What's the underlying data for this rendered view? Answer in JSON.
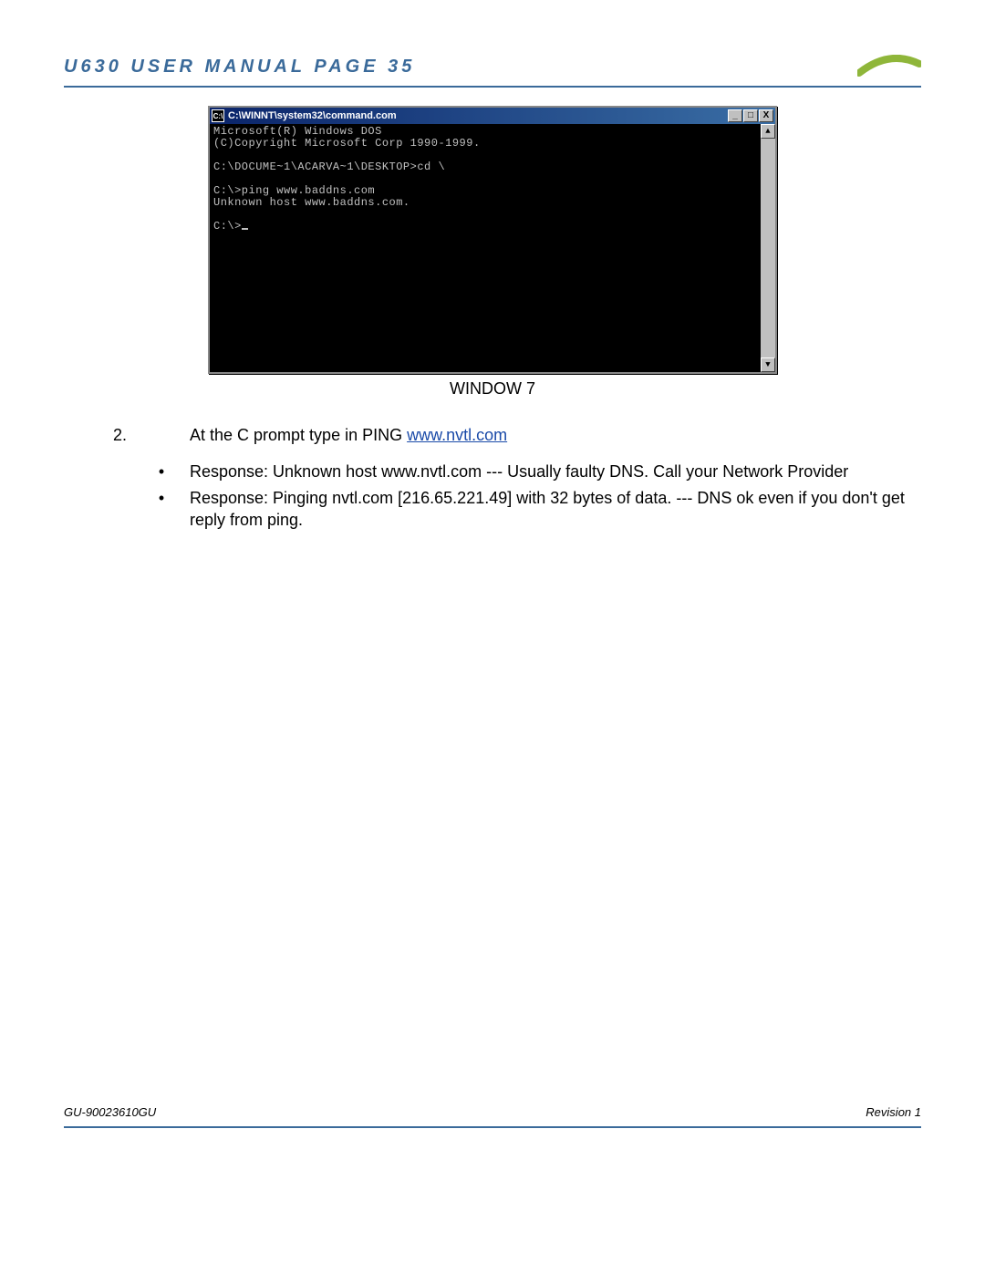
{
  "header": {
    "title": "U630 USER MANUAL PAGE 35"
  },
  "cmd": {
    "title_path": "C:\\WINNT\\system32\\command.com",
    "lines": {
      "l1": "Microsoft(R) Windows DOS",
      "l2": "(C)Copyright Microsoft Corp 1990-1999.",
      "l3": "",
      "l4": "C:\\DOCUME~1\\ACARVA~1\\DESKTOP>cd \\",
      "l5": "",
      "l6": "C:\\>ping www.baddns.com",
      "l7": "Unknown host www.baddns.com.",
      "l8": "",
      "l9_prefix": "C:\\>"
    }
  },
  "caption": "WINDOW 7",
  "step": {
    "num": "2.",
    "text_prefix": "At the C prompt type in PING ",
    "link": "www.nvtl.com"
  },
  "bullets": {
    "b1": "Response:  Unknown host www.nvtl.com --- Usually faulty DNS.  Call your Network Provider",
    "b2": "Response:  Pinging nvtl.com [216.65.221.49] with 32 bytes of data.  --- DNS ok even if you don't get reply from ping."
  },
  "footer": {
    "left": "GU-90023610GU",
    "right": "Revision 1"
  },
  "glyphs": {
    "bullet": "•",
    "min": "_",
    "max": "□",
    "close": "X",
    "up": "▲",
    "down": "▼",
    "sys": "C:\\"
  }
}
